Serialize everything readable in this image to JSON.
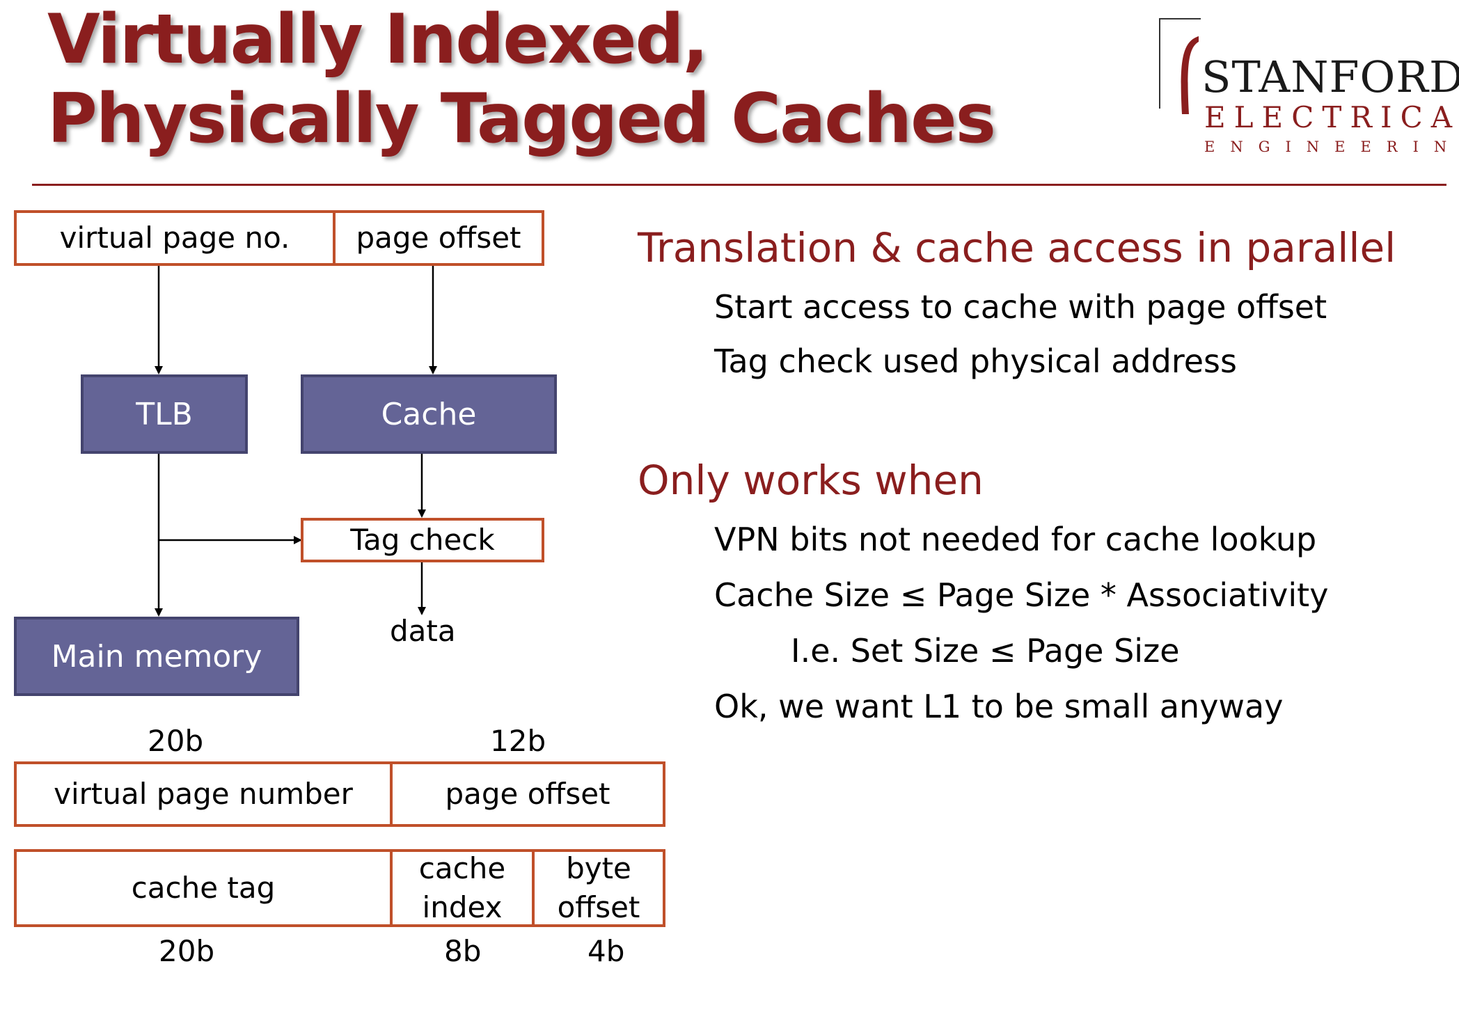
{
  "title": {
    "line1": "Virtually Indexed,",
    "line2": "Physically Tagged Caches"
  },
  "logo": {
    "line1": "STANFORD",
    "line2": "ELECTRICAL",
    "line3": "ENGINEERING",
    "accent_color": "#8a1e1e"
  },
  "diagram": {
    "virtual_address": {
      "vpn": "virtual page no.",
      "offset": "page offset"
    },
    "tlb": "TLB",
    "cache": "Cache",
    "tag_check": "Tag check",
    "data": "data",
    "main_memory": "Main memory",
    "address_split": {
      "vpn_bits": "20b",
      "offset_bits": "12b",
      "vpn_label": "virtual page number",
      "offset_label": "page offset",
      "cache_tag_label": "cache tag",
      "cache_index_line1": "cache",
      "cache_index_line2": "index",
      "byte_offset_line1": "byte",
      "byte_offset_line2": "offset",
      "tag_bits": "20b",
      "index_bits": "8b",
      "byte_bits": "4b"
    },
    "colors": {
      "outline": "#c0502a",
      "block_fill": "#646496",
      "block_border": "#44446e"
    }
  },
  "content": {
    "section1": {
      "heading": "Translation & cache access in parallel",
      "items": [
        "Start access to cache with page offset",
        "Tag check used physical address"
      ]
    },
    "section2": {
      "heading": "Only works when",
      "items": [
        "VPN bits not needed for cache lookup",
        "Cache Size ≤ Page Size * Associativity"
      ],
      "sub_item": "I.e. Set Size ≤ Page Size",
      "last_item": "Ok, we want L1 to be small anyway"
    }
  }
}
